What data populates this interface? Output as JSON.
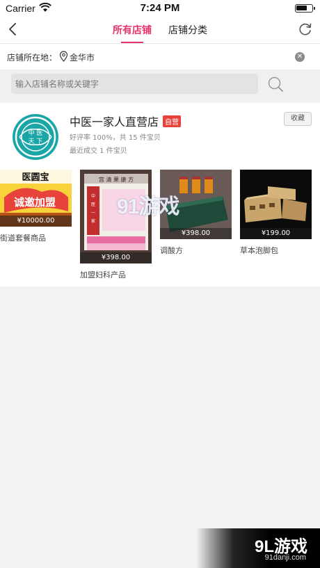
{
  "status_bar": {
    "carrier": "Carrier",
    "time": "7:24 PM"
  },
  "nav": {
    "tabs": [
      {
        "label": "所有店铺",
        "active": true
      },
      {
        "label": "店铺分类",
        "active": false
      }
    ]
  },
  "location": {
    "label": "店铺所在地：",
    "city": "金华市"
  },
  "search": {
    "placeholder": "输入店铺名称或关键字"
  },
  "shop": {
    "name": "中医一家人直营店",
    "badge": "自营",
    "rating": "好评率 100%，共 15 件宝贝",
    "recent": "最近成交 1 件宝贝",
    "collect_label": "收藏",
    "logo_text": "中医天下"
  },
  "products": [
    {
      "name": "街道套餐商品",
      "price": "¥10000.00",
      "image_text": "医圆宝 诚邀加盟"
    },
    {
      "name": "加盟妇科产品",
      "price": "¥398.00",
      "image_text": "中医一家人"
    },
    {
      "name": "调酸方",
      "price": "¥398.00"
    },
    {
      "name": "草本泡脚包",
      "price": "¥199.00"
    }
  ],
  "watermarks": {
    "center": "91游戏",
    "corner_big": "9L游戏",
    "corner_small": "91danji.com"
  },
  "colors": {
    "accent": "#e8336b",
    "badge": "#e8433b"
  }
}
